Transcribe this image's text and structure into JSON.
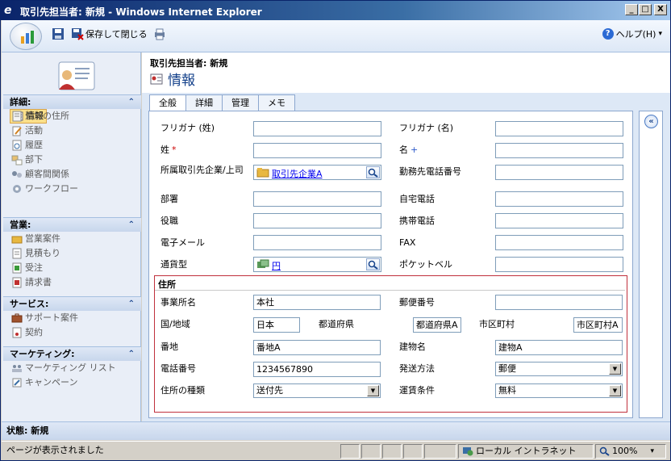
{
  "window": {
    "title": "取引先担当者: 新規 - Windows Internet Explorer",
    "min": "_",
    "max": "□",
    "close": "X"
  },
  "toolbar": {
    "save_close_label": "保存して閉じる",
    "help_label": "ヘルプ(H)",
    "help_caret": "▾"
  },
  "record": {
    "type_label": "取引先担当者: 新規",
    "section_title": "情報"
  },
  "sidebar": {
    "sections": [
      {
        "title": "詳細:",
        "items": [
          "情報",
          "追加の住所",
          "活動",
          "履歴",
          "部下",
          "顧客間関係",
          "ワークフロー"
        ]
      },
      {
        "title": "営業:",
        "items": [
          "営業案件",
          "見積もり",
          "受注",
          "請求書"
        ]
      },
      {
        "title": "サービス:",
        "items": [
          "サポート案件",
          "契約"
        ]
      },
      {
        "title": "マーケティング:",
        "items": [
          "マーケティング リスト",
          "キャンペーン"
        ]
      }
    ],
    "collapse_glyph": "⌃"
  },
  "tabs": [
    "全般",
    "詳細",
    "管理",
    "メモ"
  ],
  "form": {
    "furigana_last_label": "フリガナ (姓)",
    "furigana_first_label": "フリガナ (名)",
    "last_name_label": "姓",
    "last_name_mark": "*",
    "first_name_label": "名",
    "first_name_mark": "+",
    "parent_label": "所属取引先企業/上司",
    "parent_value": "取引先企業A",
    "business_phone_label": "勤務先電話番号",
    "department_label": "部署",
    "home_phone_label": "自宅電話",
    "job_title_label": "役職",
    "mobile_label": "携帯電話",
    "email_label": "電子メール",
    "fax_label": "FAX",
    "currency_label": "通貨型",
    "currency_value": "円",
    "pager_label": "ポケットベル"
  },
  "address": {
    "title": "住所",
    "name_label": "事業所名",
    "name_value": "本社",
    "zip_label": "郵便番号",
    "country_label": "国/地域",
    "country_value": "日本",
    "state_label": "都道府県",
    "state_value": "都道府県A",
    "city_label": "市区町村",
    "city_value": "市区町村A",
    "street_label": "番地",
    "street_value": "番地A",
    "building_label": "建物名",
    "building_value": "建物A",
    "phone_label": "電話番号",
    "phone_value": "1234567890",
    "shipping_label": "発送方法",
    "shipping_value": "郵便",
    "type_label": "住所の種類",
    "type_value": "送付先",
    "freight_label": "運賃条件",
    "freight_value": "無料"
  },
  "status": {
    "label": "状態: 新規"
  },
  "ie_status": {
    "message": "ページが表示されました",
    "zone": "ローカル イントラネット",
    "zoom": "100%",
    "zoom_caret": "▾"
  },
  "colors": {
    "required": "#cc0000",
    "recommended": "#2a58c9",
    "address_border": "#c0303c"
  }
}
